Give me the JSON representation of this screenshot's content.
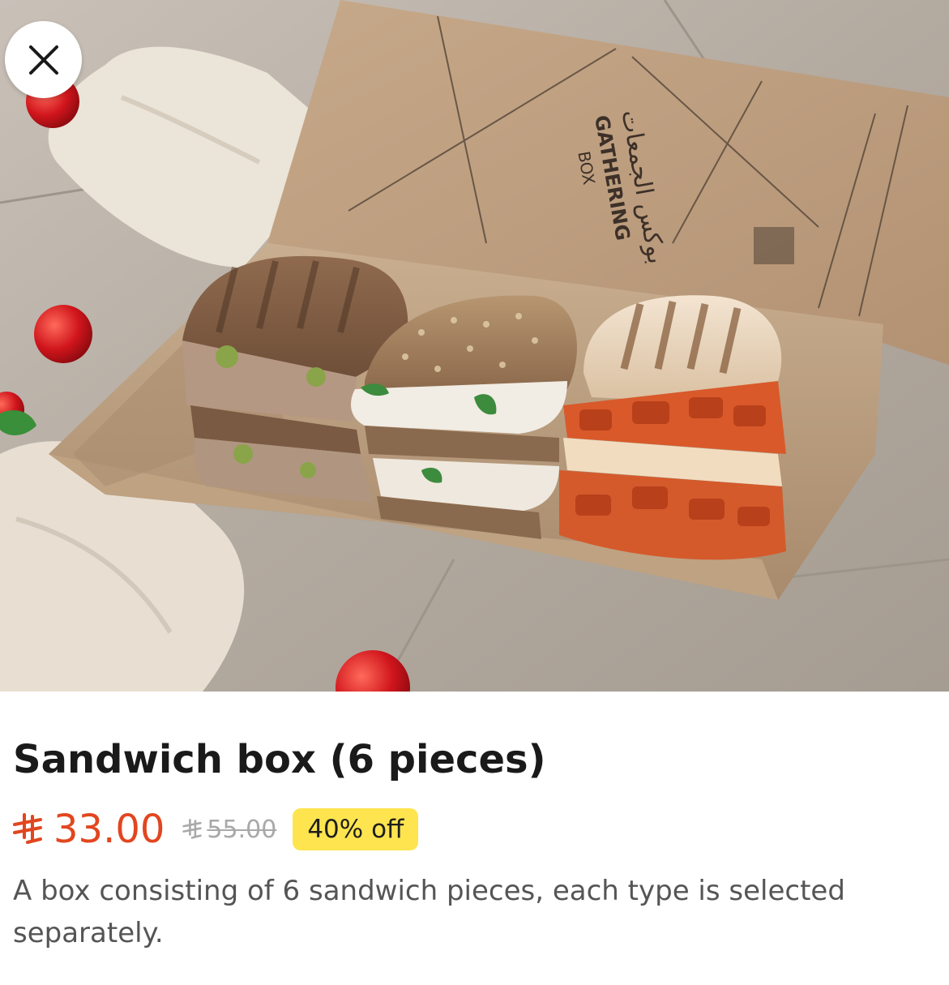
{
  "product": {
    "title": "Sandwich box (6 pieces)",
    "price": "33.00",
    "original_price": "55.00",
    "currency_icon": "saudi-riyal-icon",
    "discount_label": "40% off",
    "description": "A box consisting of 6 sandwich pieces, each type is selected separately."
  },
  "image": {
    "box_lid_arabic": "بوكس الجمعات",
    "box_lid_english": "GATHERING",
    "box_lid_sub": "BOX"
  },
  "colors": {
    "price": "#e2461f",
    "badge": "#fee54f",
    "strikethrough": "#a9a9a9",
    "title": "#1a1a1a",
    "description": "#555555"
  },
  "icons": {
    "close": "close-icon"
  }
}
